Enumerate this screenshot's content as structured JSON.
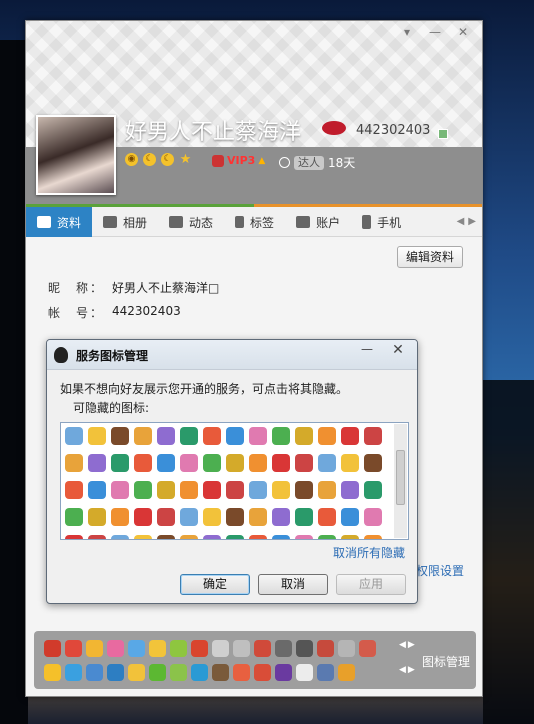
{
  "window": {
    "controls": [
      "skin-icon",
      "minimize-icon",
      "close-icon"
    ]
  },
  "profile": {
    "nickname": "好男人不止蔡海洋",
    "account_number": "442302403",
    "vip_label": "VIP3",
    "talent_tag": "达人",
    "talent_days": "18天"
  },
  "tabs": [
    {
      "label": "资料",
      "icon": "profile-card-icon",
      "active": true
    },
    {
      "label": "相册",
      "icon": "photo-album-icon",
      "active": false
    },
    {
      "label": "动态",
      "icon": "feed-list-icon",
      "active": false
    },
    {
      "label": "标签",
      "icon": "bookmark-icon",
      "active": false
    },
    {
      "label": "账户",
      "icon": "wallet-icon",
      "active": false
    },
    {
      "label": "手机",
      "icon": "phone-icon",
      "active": false
    }
  ],
  "content": {
    "edit_button": "编辑资料",
    "nickname_label": "昵　称：",
    "nickname_value": "好男人不止蔡海洋□",
    "account_label": "帐　号：",
    "account_value": "442302403",
    "privacy_link": "权限设置"
  },
  "dialog": {
    "title": "服务图标管理",
    "instruction": "如果不想向好友展示您开通的服务，可点击将其隐藏。",
    "hideable_label": "可隐藏的图标:",
    "unhide_all": "取消所有隐藏",
    "ok": "确定",
    "cancel": "取消",
    "apply": "应用"
  },
  "bottom": {
    "icon_manager": "图标管理"
  },
  "colors": {
    "tab_active": "#2d83c5",
    "vip_red": "#ff3333",
    "link_blue": "#2d6db5",
    "status_green": "#5aa23a",
    "status_orange": "#e8922b"
  }
}
